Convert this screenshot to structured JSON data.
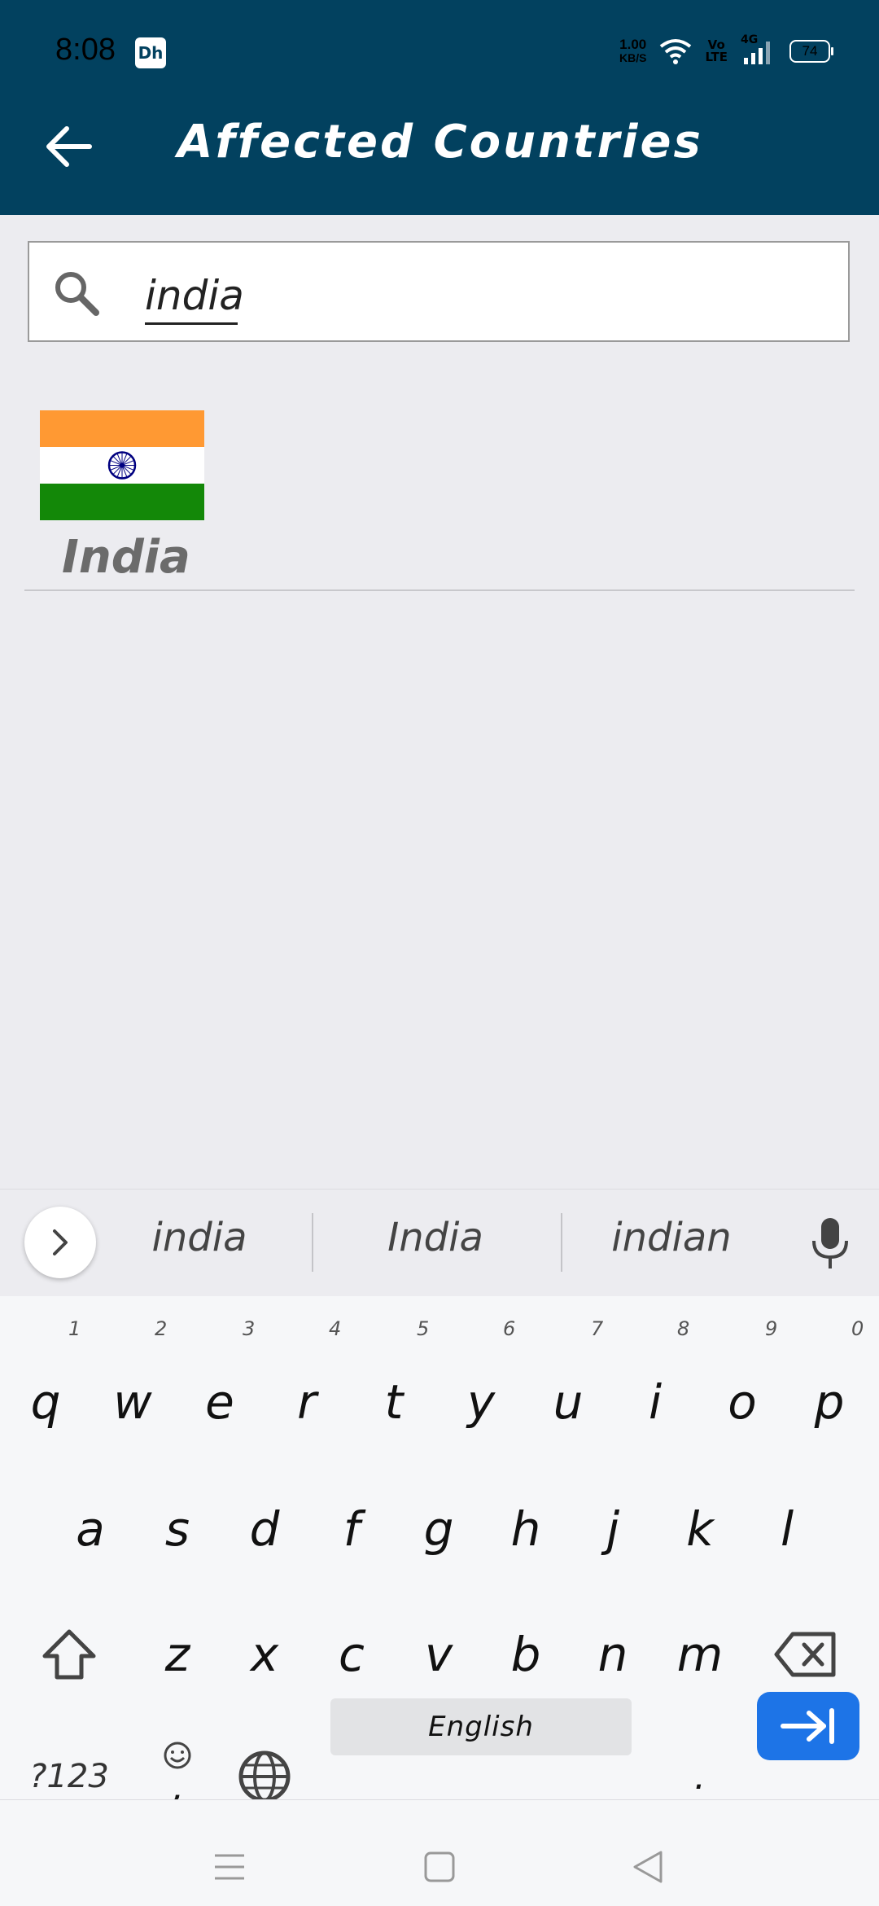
{
  "status_bar": {
    "time": "8:08",
    "app_icon_text": "Dh",
    "net_speed_value": "1.00",
    "net_speed_unit": "KB/S",
    "volte_top": "Vo",
    "volte_bottom": "LTE",
    "network_type": "4G",
    "battery": "74"
  },
  "app_bar": {
    "title": "Affected Countries",
    "back_icon": "arrow-left-icon"
  },
  "search": {
    "value": "india",
    "icon": "search-icon"
  },
  "results": [
    {
      "name": "India",
      "flag_colors": [
        "#FF9933",
        "#FFFFFF",
        "#138808"
      ],
      "chakra_color": "#000080"
    }
  ],
  "keyboard": {
    "suggestions": [
      "india",
      "India",
      "indian"
    ],
    "row1": [
      "q",
      "w",
      "e",
      "r",
      "t",
      "y",
      "u",
      "i",
      "o",
      "p"
    ],
    "row1_hints": [
      "1",
      "2",
      "3",
      "4",
      "5",
      "6",
      "7",
      "8",
      "9",
      "0"
    ],
    "row2": [
      "a",
      "s",
      "d",
      "f",
      "g",
      "h",
      "j",
      "k",
      "l"
    ],
    "row3": [
      "z",
      "x",
      "c",
      "v",
      "b",
      "n",
      "m"
    ],
    "symbols_label": "?123",
    "comma_label": ",",
    "space_label": "English",
    "period_label": ".",
    "enter_color": "#1D74E7"
  },
  "colors": {
    "app_bar": "#02415F",
    "background": "#ECECF0"
  }
}
